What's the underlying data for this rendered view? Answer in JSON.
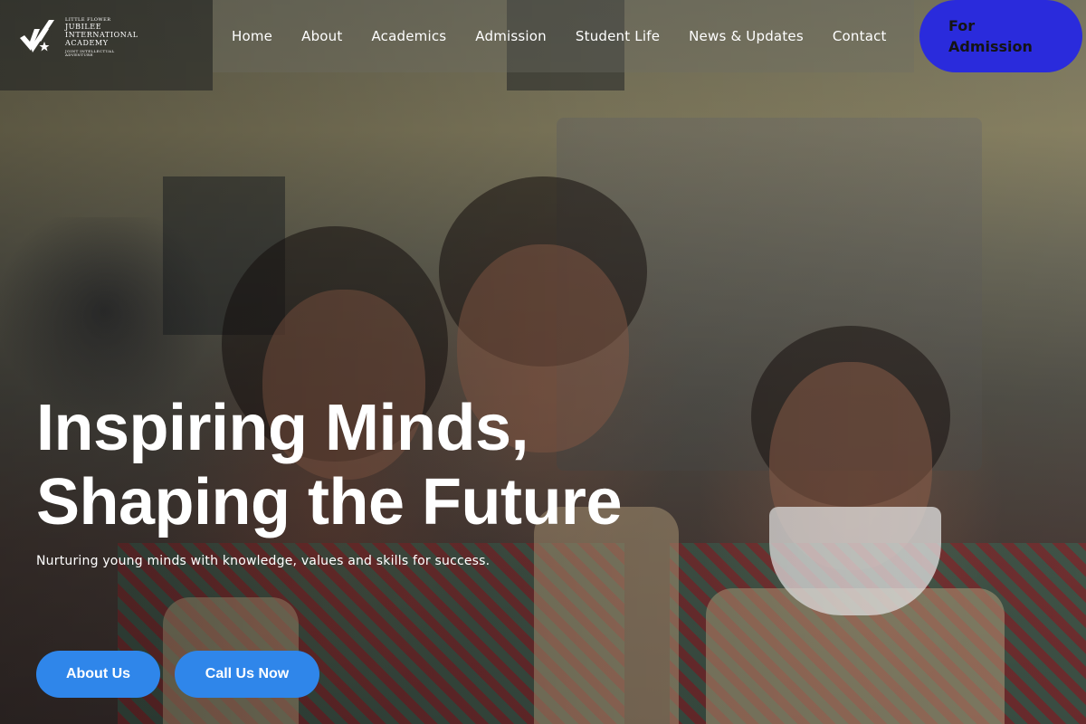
{
  "brand": {
    "small": "LITTLE FLOWER",
    "line1": "JUBILEE",
    "line2": "INTERNATIONAL",
    "line3": "ACADEMY",
    "tagline": "JOINT INTELLECTUAL ADVENTURE"
  },
  "nav": {
    "items": [
      {
        "label": "Home"
      },
      {
        "label": "About"
      },
      {
        "label": "Academics"
      },
      {
        "label": "Admission"
      },
      {
        "label": "Student Life"
      },
      {
        "label": "News & Updates"
      },
      {
        "label": "Contact"
      }
    ],
    "cta_line1": "For",
    "cta_line2": "Admission"
  },
  "hero": {
    "title_line1": "Inspiring Minds,",
    "title_line2": "Shaping the Future",
    "subtitle": "Nurturing young minds with knowledge, values and skills for success.",
    "buttons": {
      "about": "About Us",
      "call": "Call Us Now"
    }
  },
  "colors": {
    "cta_admission": "#2a2bdc",
    "hero_buttons": "#2f86ea",
    "text": "#ffffff"
  },
  "icons": {
    "logo": "school-crest-icon"
  }
}
